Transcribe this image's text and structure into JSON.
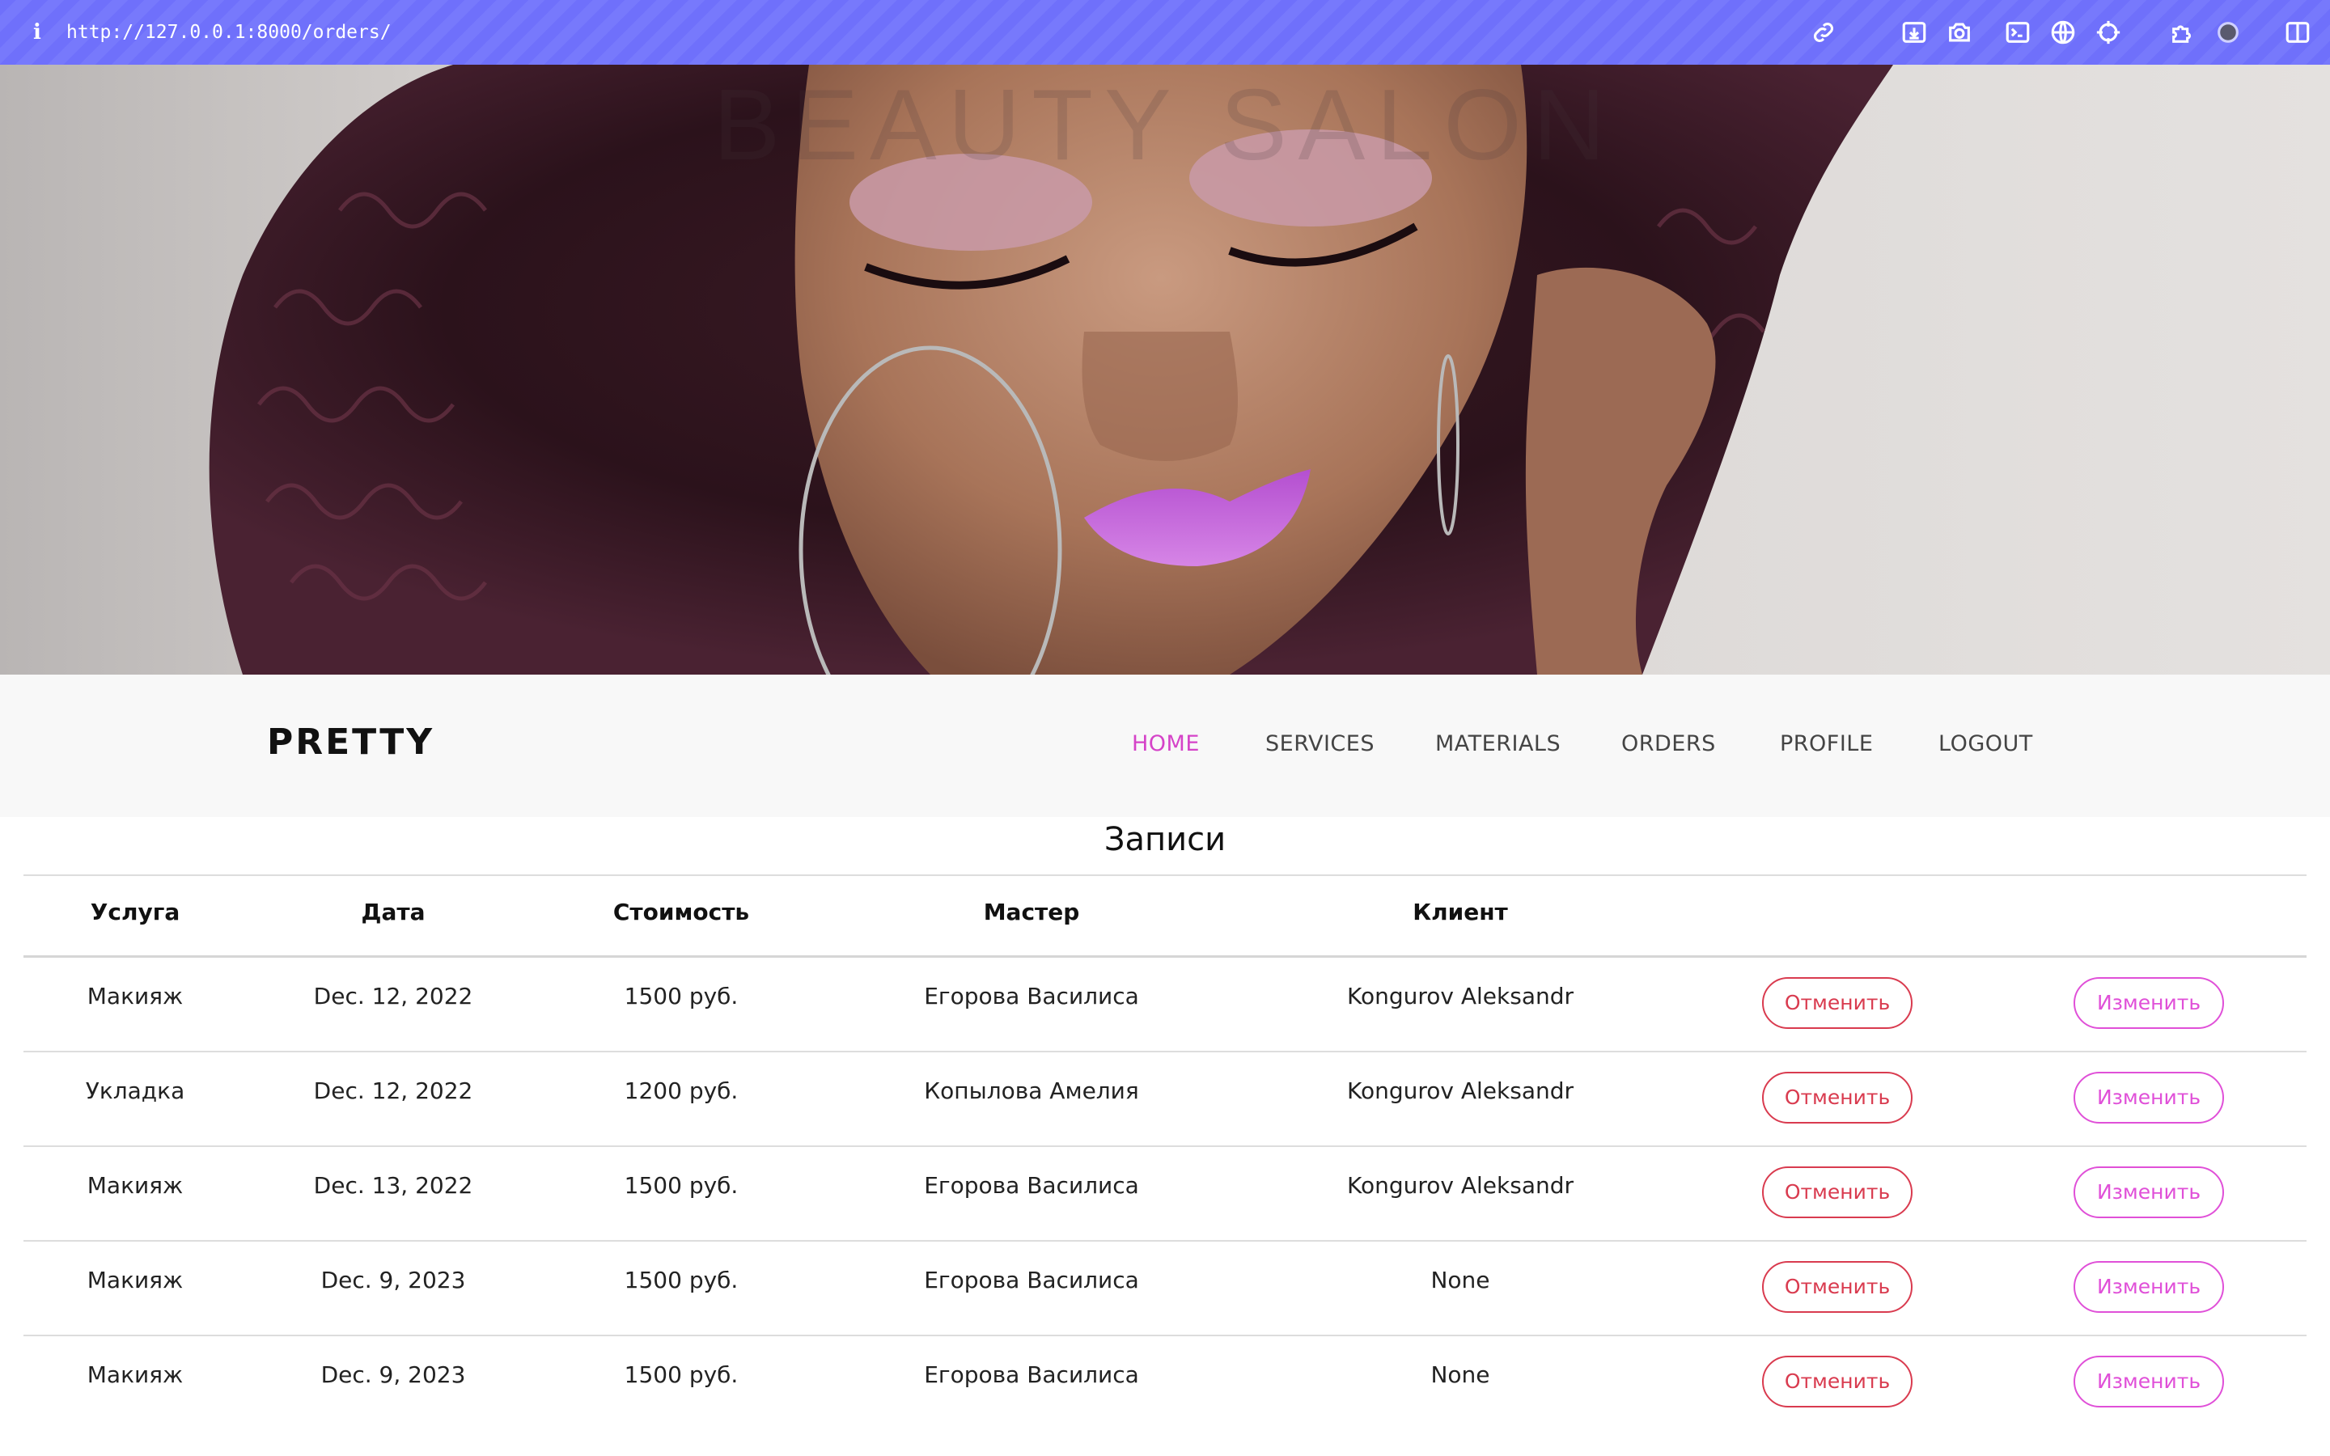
{
  "browser": {
    "url": "http://127.0.0.1:8000/orders/",
    "info_icon": "i",
    "icons": [
      "link-icon",
      "download-icon",
      "camera-icon",
      "terminal-icon",
      "globe-icon",
      "crosshair-icon",
      "puzzle-icon",
      "moon-icon",
      "sidebar-icon"
    ]
  },
  "hero": {
    "title": "BEAUTY SALON"
  },
  "navbar": {
    "brand": "PRETTY",
    "items": [
      {
        "label": "HOME",
        "active": true
      },
      {
        "label": "SERVICES",
        "active": false
      },
      {
        "label": "MATERIALS",
        "active": false
      },
      {
        "label": "ORDERS",
        "active": false
      },
      {
        "label": "PROFILE",
        "active": false
      },
      {
        "label": "LOGOUT",
        "active": false
      }
    ],
    "active_color": "#d543c8"
  },
  "orders": {
    "heading": "Записи",
    "columns": [
      "Услуга",
      "Дата",
      "Стоимость",
      "Мастер",
      "Клиент"
    ],
    "cancel_label": "Отменить",
    "edit_label": "Изменить",
    "rows": [
      {
        "service": "Макияж",
        "date": "Dec. 12, 2022",
        "price": "1500 руб.",
        "master": "Егорова Василиса",
        "client": "Kongurov Aleksandr"
      },
      {
        "service": "Укладка",
        "date": "Dec. 12, 2022",
        "price": "1200 руб.",
        "master": "Копылова Амелия",
        "client": "Kongurov Aleksandr"
      },
      {
        "service": "Макияж",
        "date": "Dec. 13, 2022",
        "price": "1500 руб.",
        "master": "Егорова Василиса",
        "client": "Kongurov Aleksandr"
      },
      {
        "service": "Макияж",
        "date": "Dec. 9, 2023",
        "price": "1500 руб.",
        "master": "Егорова Василиса",
        "client": "None"
      },
      {
        "service": "Макияж",
        "date": "Dec. 9, 2023",
        "price": "1500 руб.",
        "master": "Егорова Василиса",
        "client": "None"
      }
    ],
    "colors": {
      "cancel": "#d93b4f",
      "edit": "#e050d8"
    }
  }
}
